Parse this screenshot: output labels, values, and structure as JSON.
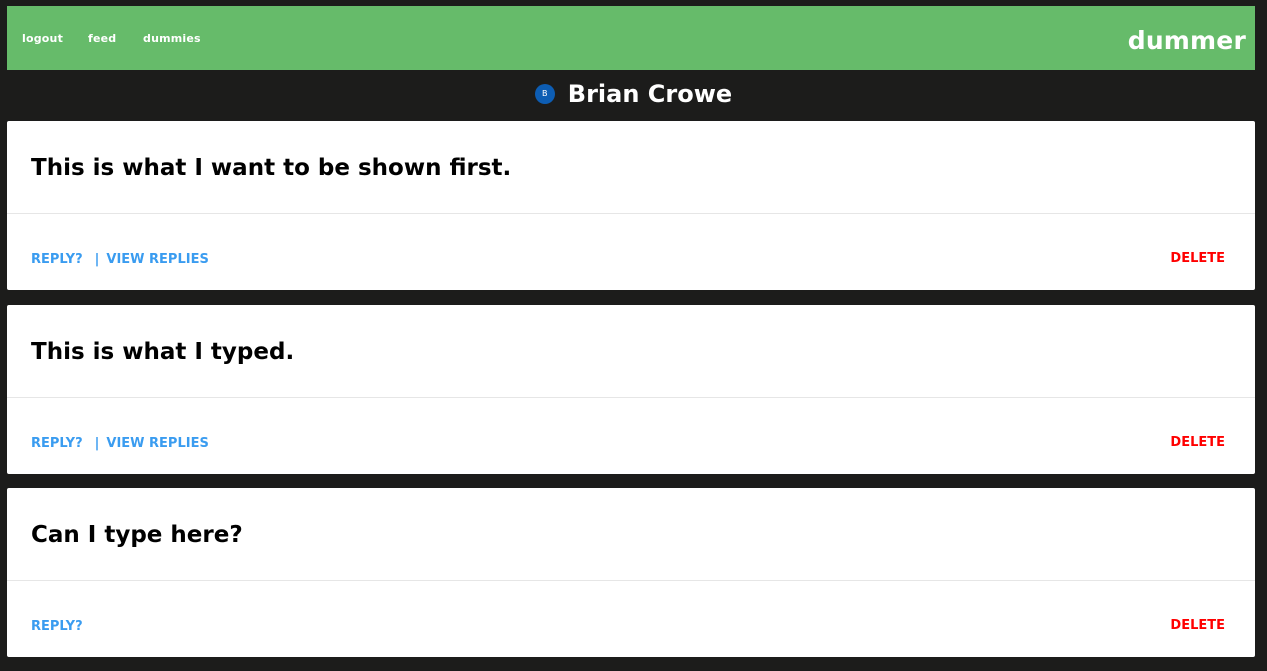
{
  "nav": {
    "links": [
      "logout",
      "feed",
      "dummies"
    ],
    "brand": "dummer"
  },
  "profile": {
    "avatar_initial": "B",
    "name": "Brian Crowe"
  },
  "posts": [
    {
      "text": "This is what I want to be shown first.",
      "reply_label": "REPLY?",
      "separator": "|",
      "view_replies_label": "VIEW REPLIES",
      "delete_label": "DELETE"
    },
    {
      "text": "This is what I typed.",
      "reply_label": "REPLY?",
      "separator": "|",
      "view_replies_label": "VIEW REPLIES",
      "delete_label": "DELETE"
    },
    {
      "text": "Can I type here?",
      "reply_label": "REPLY?",
      "delete_label": "DELETE"
    }
  ],
  "colors": {
    "background": "#1c1c1b",
    "navbar": "#66bb6a",
    "link": "#3a9cf0",
    "delete": "#ff0000",
    "avatar": "#0d5db3"
  }
}
